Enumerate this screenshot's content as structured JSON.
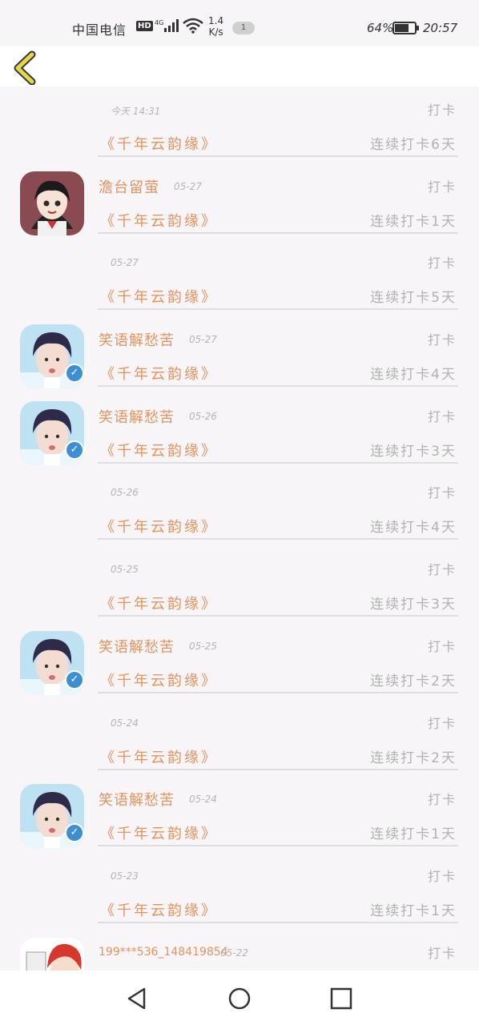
{
  "status_bar": {
    "carrier": "中国电信",
    "network": "HD",
    "signal_label": "4G",
    "speed_value": "1.4",
    "speed_unit": "K/s",
    "notification_count": "1",
    "battery": "64%",
    "time": "20:57"
  },
  "nav": {
    "back_icon": "chevron-left-icon"
  },
  "items": [
    {
      "user": "",
      "date": "今天 14:31",
      "action": "打卡",
      "book": "《千年云韵缘》",
      "streak": "连续打卡6天",
      "avatar": "",
      "verified": false
    },
    {
      "user": "澹台留萤",
      "date": "05-27",
      "action": "打卡",
      "book": "《千年云韵缘》",
      "streak": "连续打卡1天",
      "avatar": "anime-girl",
      "verified": false
    },
    {
      "user": "",
      "date": "05-27",
      "action": "打卡",
      "book": "《千年云韵缘》",
      "streak": "连续打卡5天",
      "avatar": "",
      "verified": false
    },
    {
      "user": "笑语解愁苦",
      "date": "05-27",
      "action": "打卡",
      "book": "《千年云韵缘》",
      "streak": "连续打卡4天",
      "avatar": "boy",
      "verified": true
    },
    {
      "user": "笑语解愁苦",
      "date": "05-26",
      "action": "打卡",
      "book": "《千年云韵缘》",
      "streak": "连续打卡3天",
      "avatar": "boy",
      "verified": true
    },
    {
      "user": "",
      "date": "05-26",
      "action": "打卡",
      "book": "《千年云韵缘》",
      "streak": "连续打卡4天",
      "avatar": "",
      "verified": false
    },
    {
      "user": "",
      "date": "05-25",
      "action": "打卡",
      "book": "《千年云韵缘》",
      "streak": "连续打卡3天",
      "avatar": "",
      "verified": false
    },
    {
      "user": "笑语解愁苦",
      "date": "05-25",
      "action": "打卡",
      "book": "《千年云韵缘》",
      "streak": "连续打卡2天",
      "avatar": "boy",
      "verified": true
    },
    {
      "user": "",
      "date": "05-24",
      "action": "打卡",
      "book": "《千年云韵缘》",
      "streak": "连续打卡2天",
      "avatar": "",
      "verified": false
    },
    {
      "user": "笑语解愁苦",
      "date": "05-24",
      "action": "打卡",
      "book": "《千年云韵缘》",
      "streak": "连续打卡1天",
      "avatar": "boy",
      "verified": true
    },
    {
      "user": "",
      "date": "05-23",
      "action": "打卡",
      "book": "《千年云韵缘》",
      "streak": "连续打卡1天",
      "avatar": "",
      "verified": false
    },
    {
      "user": "199***536_148419854",
      "date": "05-22",
      "action": "打卡",
      "book": "",
      "streak": "",
      "avatar": "red-hair",
      "verified": false
    }
  ],
  "system_nav": {
    "back": "triangle-back-icon",
    "home": "circle-home-icon",
    "recent": "square-recent-icon"
  },
  "colors": {
    "accent": "#e3935f",
    "muted": "#b2b2b2",
    "verify": "#3d8fd1",
    "back_icon": "#e8d64a"
  }
}
